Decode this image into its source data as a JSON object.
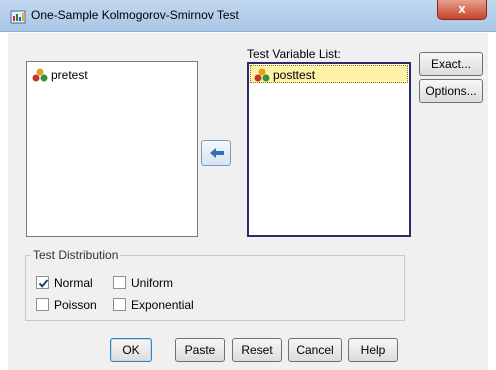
{
  "window": {
    "title": "One-Sample Kolmogorov-Smirnov Test",
    "close_label": "x"
  },
  "source_list": {
    "items": [
      {
        "label": "pretest",
        "icon": "scale-variable-icon"
      }
    ]
  },
  "target_list": {
    "label": "Test Variable List:",
    "items": [
      {
        "label": "posttest",
        "icon": "scale-variable-icon",
        "selected": true
      }
    ]
  },
  "move_button": {
    "icon": "arrow-left-icon"
  },
  "side_buttons": {
    "exact": "Exact...",
    "options": "Options..."
  },
  "distribution_group": {
    "title": "Test Distribution",
    "options": [
      {
        "label": "Normal",
        "checked": true
      },
      {
        "label": "Uniform",
        "checked": false
      },
      {
        "label": "Poisson",
        "checked": false
      },
      {
        "label": "Exponential",
        "checked": false
      }
    ]
  },
  "buttons": {
    "ok": "OK",
    "paste": "Paste",
    "reset": "Reset",
    "cancel": "Cancel",
    "help": "Help"
  },
  "colors": {
    "titlebar": "#b8d1ec",
    "close": "#c7432b",
    "selection": "#fff2a6",
    "arrow": "#2f6fb5"
  }
}
